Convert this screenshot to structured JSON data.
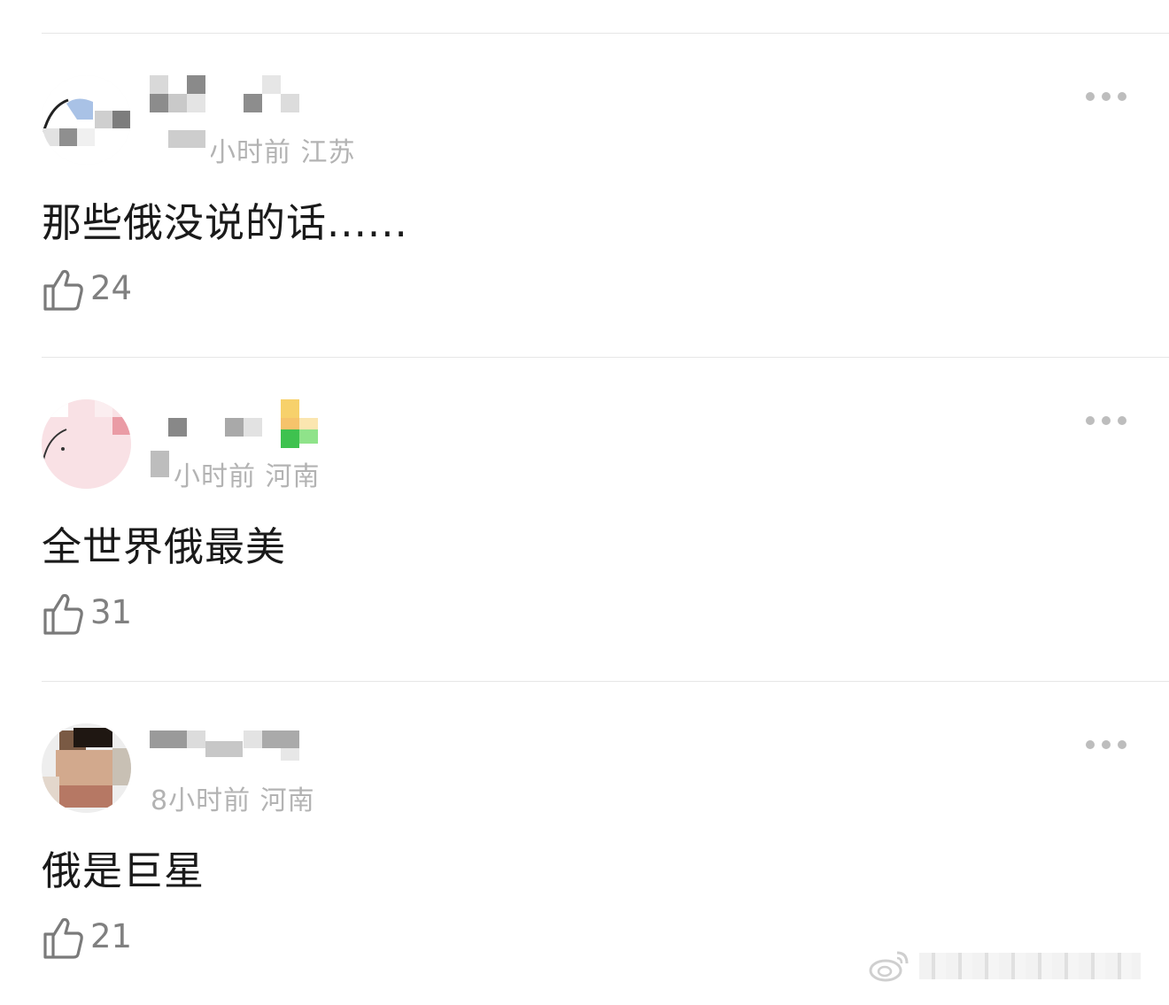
{
  "comments": [
    {
      "meta": "小时前 江苏",
      "text": "那些俄没说的话......",
      "likes": "24",
      "avatar_colors": [
        "#f4f4f4",
        "#9fb8dc",
        "#888888",
        "#cccccc"
      ]
    },
    {
      "meta": "小时前 河南",
      "text": "全世界俄最美",
      "likes": "31",
      "avatar_colors": [
        "#f9e0e4",
        "#f4c6cc",
        "#e99aa4",
        "#ffffff"
      ]
    },
    {
      "meta": "8小时前 河南",
      "text": "俄是巨星",
      "likes": "21",
      "avatar_colors": [
        "#d6b59b",
        "#2a1f1a",
        "#c98e6e",
        "#eeeeee"
      ]
    }
  ],
  "more_icon": "ellipsis-icon",
  "like_icon": "thumbs-up-icon",
  "watermark_icon": "weibo-logo-icon"
}
